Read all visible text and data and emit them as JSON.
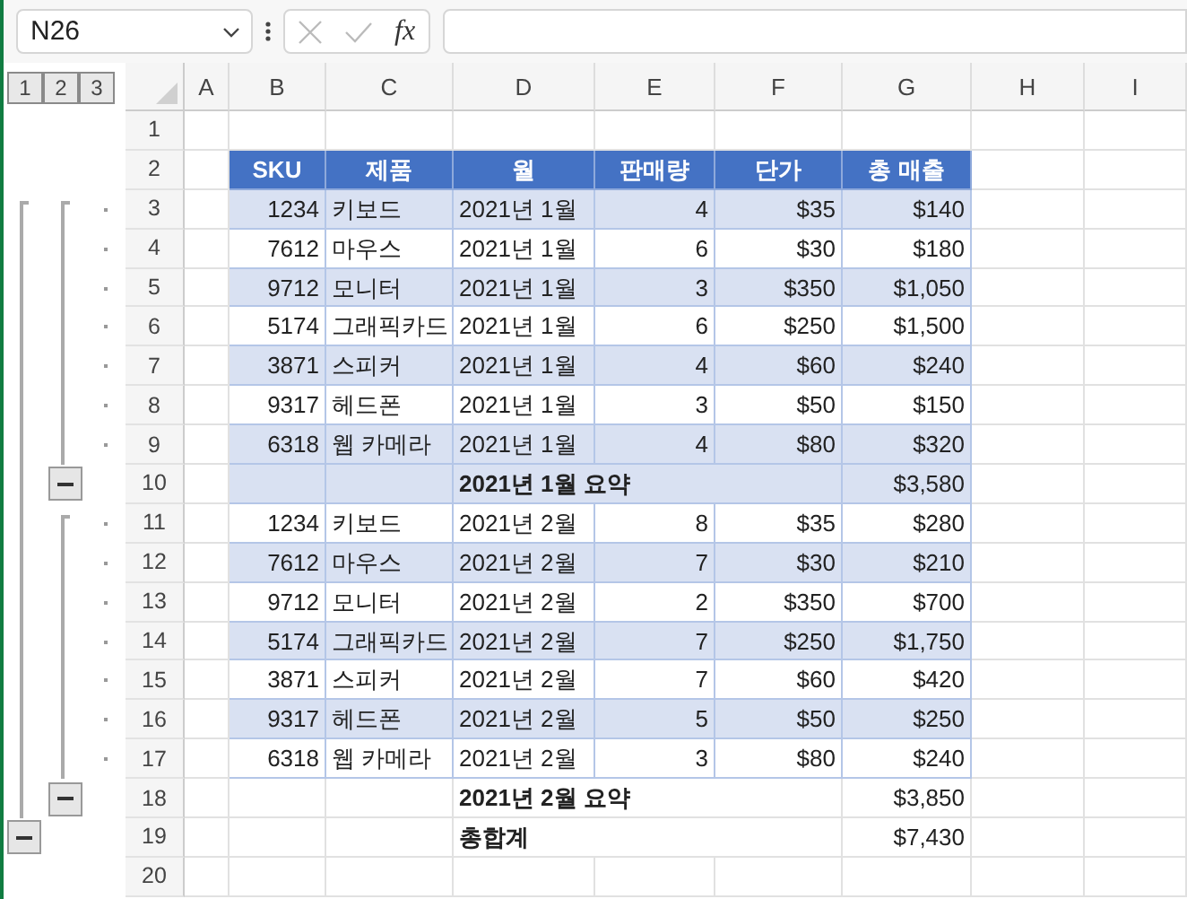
{
  "name_box": {
    "value": "N26"
  },
  "formula_bar": {
    "fx_label": "fx"
  },
  "outline_levels": [
    "1",
    "2",
    "3"
  ],
  "columns": [
    "A",
    "B",
    "C",
    "D",
    "E",
    "F",
    "G",
    "H",
    "I"
  ],
  "rows": [
    {
      "number": "1",
      "kind": "empty"
    },
    {
      "number": "2",
      "kind": "header",
      "cells": [
        "SKU",
        "제품",
        "월",
        "판매량",
        "단가",
        "총 매출"
      ]
    },
    {
      "number": "3",
      "kind": "data",
      "shaded": true,
      "outline": {
        "kind": "dot"
      },
      "cells": [
        "1234",
        "키보드",
        "2021년 1월",
        "4",
        "$35",
        "$140"
      ]
    },
    {
      "number": "4",
      "kind": "data",
      "shaded": false,
      "outline": {
        "kind": "dot"
      },
      "cells": [
        "7612",
        "마우스",
        "2021년 1월",
        "6",
        "$30",
        "$180"
      ]
    },
    {
      "number": "5",
      "kind": "data",
      "shaded": true,
      "outline": {
        "kind": "dot"
      },
      "cells": [
        "9712",
        "모니터",
        "2021년 1월",
        "3",
        "$350",
        "$1,050"
      ]
    },
    {
      "number": "6",
      "kind": "data",
      "shaded": false,
      "outline": {
        "kind": "dot"
      },
      "cells": [
        "5174",
        "그래픽카드",
        "2021년 1월",
        "6",
        "$250",
        "$1,500"
      ]
    },
    {
      "number": "7",
      "kind": "data",
      "shaded": true,
      "outline": {
        "kind": "dot"
      },
      "cells": [
        "3871",
        "스피커",
        "2021년 1월",
        "4",
        "$60",
        "$240"
      ]
    },
    {
      "number": "8",
      "kind": "data",
      "shaded": false,
      "outline": {
        "kind": "dot"
      },
      "cells": [
        "9317",
        "헤드폰",
        "2021년 1월",
        "3",
        "$50",
        "$150"
      ]
    },
    {
      "number": "9",
      "kind": "data",
      "shaded": true,
      "outline": {
        "kind": "dot"
      },
      "cells": [
        "6318",
        "웹 카메라",
        "2021년 1월",
        "4",
        "$80",
        "$320"
      ]
    },
    {
      "number": "10",
      "kind": "summary",
      "shaded": true,
      "outline": {
        "kind": "collapse-2"
      },
      "label": "2021년 1월 요약",
      "amount": "$3,580"
    },
    {
      "number": "11",
      "kind": "data",
      "shaded": false,
      "outline": {
        "kind": "dot"
      },
      "cells": [
        "1234",
        "키보드",
        "2021년 2월",
        "8",
        "$35",
        "$280"
      ]
    },
    {
      "number": "12",
      "kind": "data",
      "shaded": true,
      "outline": {
        "kind": "dot"
      },
      "cells": [
        "7612",
        "마우스",
        "2021년 2월",
        "7",
        "$30",
        "$210"
      ]
    },
    {
      "number": "13",
      "kind": "data",
      "shaded": false,
      "outline": {
        "kind": "dot"
      },
      "cells": [
        "9712",
        "모니터",
        "2021년 2월",
        "2",
        "$350",
        "$700"
      ]
    },
    {
      "number": "14",
      "kind": "data",
      "shaded": true,
      "outline": {
        "kind": "dot"
      },
      "cells": [
        "5174",
        "그래픽카드",
        "2021년 2월",
        "7",
        "$250",
        "$1,750"
      ]
    },
    {
      "number": "15",
      "kind": "data",
      "shaded": false,
      "outline": {
        "kind": "dot"
      },
      "cells": [
        "3871",
        "스피커",
        "2021년 2월",
        "7",
        "$60",
        "$420"
      ]
    },
    {
      "number": "16",
      "kind": "data",
      "shaded": true,
      "outline": {
        "kind": "dot"
      },
      "cells": [
        "9317",
        "헤드폰",
        "2021년 2월",
        "5",
        "$50",
        "$250"
      ]
    },
    {
      "number": "17",
      "kind": "data",
      "shaded": false,
      "outline": {
        "kind": "dot"
      },
      "cells": [
        "6318",
        "웹 카메라",
        "2021년 2월",
        "3",
        "$80",
        "$240"
      ]
    },
    {
      "number": "18",
      "kind": "summary",
      "shaded": false,
      "outline": {
        "kind": "collapse-2"
      },
      "label": "2021년 2월 요약",
      "amount": "$3,850"
    },
    {
      "number": "19",
      "kind": "summary",
      "shaded": false,
      "outline": {
        "kind": "collapse-1"
      },
      "label": "총합계",
      "amount": "$7,430"
    },
    {
      "number": "20",
      "kind": "empty"
    }
  ]
}
